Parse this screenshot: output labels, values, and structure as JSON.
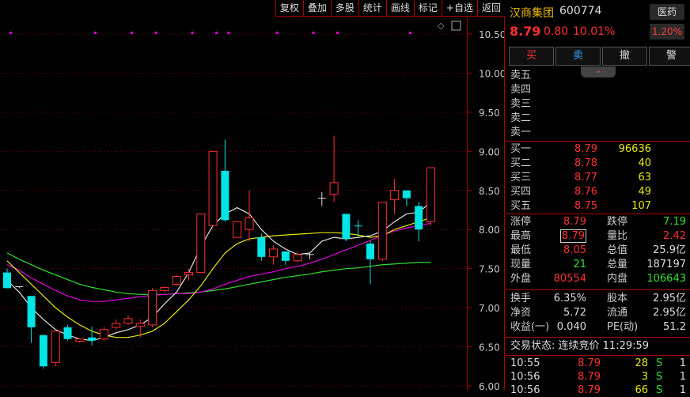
{
  "toolbar": {
    "items": [
      "复权",
      "叠加",
      "多股",
      "统计",
      "画线",
      "标记",
      "+自选",
      "返回"
    ]
  },
  "stock": {
    "name": "汉商集团",
    "code": "600774",
    "price": "8.79",
    "change": "0.80",
    "change_pct": "10.01%",
    "sector": "医药",
    "sector_pct": "1.20%"
  },
  "trade_buttons": [
    "买",
    "卖",
    "撤",
    "警"
  ],
  "order_book": {
    "asks": [
      {
        "label": "卖五",
        "price": "",
        "vol": ""
      },
      {
        "label": "卖四",
        "price": "",
        "vol": ""
      },
      {
        "label": "卖三",
        "price": "",
        "vol": ""
      },
      {
        "label": "卖二",
        "price": "",
        "vol": ""
      },
      {
        "label": "卖一",
        "price": "",
        "vol": ""
      }
    ],
    "bids": [
      {
        "label": "买一",
        "price": "8.79",
        "vol": "96636"
      },
      {
        "label": "买二",
        "price": "8.78",
        "vol": "40"
      },
      {
        "label": "买三",
        "price": "8.77",
        "vol": "63"
      },
      {
        "label": "买四",
        "price": "8.76",
        "vol": "49"
      },
      {
        "label": "买五",
        "price": "8.75",
        "vol": "107"
      }
    ]
  },
  "stats": [
    {
      "l1": "涨停",
      "v1": "8.79",
      "c1": "red",
      "l2": "跌停",
      "v2": "7.19",
      "c2": "green"
    },
    {
      "l1": "最高",
      "v1": "8.79",
      "c1": "red",
      "l2": "量比",
      "v2": "2.42",
      "c2": "red",
      "box1": true
    },
    {
      "l1": "最低",
      "v1": "8.05",
      "c1": "red",
      "l2": "总值",
      "v2": "25.9亿",
      "c2": "white"
    },
    {
      "l1": "现量",
      "v1": "21",
      "c1": "green",
      "l2": "总量",
      "v2": "187197",
      "c2": "white"
    },
    {
      "l1": "外盘",
      "v1": "80554",
      "c1": "red",
      "l2": "内盘",
      "v2": "106643",
      "c2": "green"
    }
  ],
  "stats2": [
    {
      "l1": "换手",
      "v1": "6.35%",
      "c1": "white",
      "l2": "股本",
      "v2": "2.95亿",
      "c2": "white"
    },
    {
      "l1": "净资",
      "v1": "5.72",
      "c1": "white",
      "l2": "流通",
      "v2": "2.95亿",
      "c2": "white"
    },
    {
      "l1": "收益(一)",
      "v1": "0.040",
      "c1": "white",
      "l2": "PE(动)",
      "v2": "51.2",
      "c2": "white"
    }
  ],
  "trade_status": "交易状态: 连续竞价 11:29:59",
  "ticks": [
    {
      "t": "10:55",
      "p": "8.79",
      "v": "28",
      "s": "S",
      "n": "1"
    },
    {
      "t": "10:56",
      "p": "8.79",
      "v": "3",
      "s": "S",
      "n": "1"
    },
    {
      "t": "10:56",
      "p": "8.79",
      "v": "66",
      "s": "S",
      "n": "1"
    }
  ],
  "chart_data": {
    "type": "candlestick",
    "ylim": [
      6.0,
      10.5
    ],
    "y_ticks": [
      "10.50",
      "10.00",
      "9.50",
      "9.00",
      "8.50",
      "8.00",
      "7.50",
      "7.00",
      "6.50",
      "6.00"
    ],
    "candles": [
      {
        "o": 7.45,
        "h": 7.5,
        "l": 7.25,
        "c": 7.25,
        "dir": "down"
      },
      {
        "o": 7.27,
        "h": 7.27,
        "l": 7.25,
        "c": 7.26,
        "dir": "flat"
      },
      {
        "o": 7.15,
        "h": 7.15,
        "l": 6.55,
        "c": 6.75,
        "dir": "down"
      },
      {
        "o": 6.65,
        "h": 6.65,
        "l": 6.22,
        "c": 6.25,
        "dir": "down"
      },
      {
        "o": 6.3,
        "h": 6.7,
        "l": 6.25,
        "c": 6.7,
        "dir": "up"
      },
      {
        "o": 6.75,
        "h": 6.78,
        "l": 6.58,
        "c": 6.6,
        "dir": "down"
      },
      {
        "o": 6.6,
        "h": 6.6,
        "l": 6.55,
        "c": 6.57,
        "dir": "up"
      },
      {
        "o": 6.58,
        "h": 6.76,
        "l": 6.52,
        "c": 6.62,
        "dir": "down"
      },
      {
        "o": 6.6,
        "h": 6.75,
        "l": 6.58,
        "c": 6.72,
        "dir": "up"
      },
      {
        "o": 6.75,
        "h": 6.85,
        "l": 6.72,
        "c": 6.8,
        "dir": "up"
      },
      {
        "o": 6.8,
        "h": 6.9,
        "l": 6.78,
        "c": 6.86,
        "dir": "up"
      },
      {
        "o": 6.8,
        "h": 6.85,
        "l": 6.62,
        "c": 6.76,
        "dir": "up"
      },
      {
        "o": 6.78,
        "h": 7.25,
        "l": 6.75,
        "c": 7.22,
        "dir": "up"
      },
      {
        "o": 7.22,
        "h": 7.28,
        "l": 7.2,
        "c": 7.26,
        "dir": "up"
      },
      {
        "o": 7.3,
        "h": 7.42,
        "l": 7.28,
        "c": 7.4,
        "dir": "up"
      },
      {
        "o": 7.42,
        "h": 7.5,
        "l": 7.35,
        "c": 7.45,
        "dir": "up"
      },
      {
        "o": 7.45,
        "h": 8.2,
        "l": 7.45,
        "c": 8.2,
        "dir": "up"
      },
      {
        "o": 8.05,
        "h": 9.0,
        "l": 8.05,
        "c": 9.0,
        "dir": "up"
      },
      {
        "o": 8.75,
        "h": 9.15,
        "l": 8.1,
        "c": 8.12,
        "dir": "down"
      },
      {
        "o": 7.9,
        "h": 8.1,
        "l": 7.9,
        "c": 8.1,
        "dir": "up"
      },
      {
        "o": 8.0,
        "h": 8.5,
        "l": 7.85,
        "c": 8.15,
        "dir": "up"
      },
      {
        "o": 7.9,
        "h": 7.95,
        "l": 7.6,
        "c": 7.65,
        "dir": "down"
      },
      {
        "o": 7.65,
        "h": 7.8,
        "l": 7.55,
        "c": 7.75,
        "dir": "up"
      },
      {
        "o": 7.72,
        "h": 7.72,
        "l": 7.55,
        "c": 7.6,
        "dir": "down"
      },
      {
        "o": 7.6,
        "h": 7.72,
        "l": 7.58,
        "c": 7.68,
        "dir": "up"
      },
      {
        "o": 7.68,
        "h": 7.7,
        "l": 7.62,
        "c": 7.66,
        "dir": "flat"
      },
      {
        "o": 8.4,
        "h": 8.48,
        "l": 8.3,
        "c": 8.4,
        "dir": "flat"
      },
      {
        "o": 8.45,
        "h": 9.2,
        "l": 8.35,
        "c": 8.6,
        "dir": "up"
      },
      {
        "o": 8.2,
        "h": 8.2,
        "l": 7.85,
        "c": 7.88,
        "dir": "down"
      },
      {
        "o": 8.05,
        "h": 8.12,
        "l": 7.9,
        "c": 8.05,
        "dir": "down"
      },
      {
        "o": 7.62,
        "h": 7.85,
        "l": 7.3,
        "c": 7.82,
        "dir": "down"
      },
      {
        "o": 7.62,
        "h": 8.35,
        "l": 7.6,
        "c": 8.35,
        "dir": "up"
      },
      {
        "o": 8.38,
        "h": 8.65,
        "l": 8.2,
        "c": 8.5,
        "dir": "up"
      },
      {
        "o": 8.5,
        "h": 8.5,
        "l": 8.3,
        "c": 8.4,
        "dir": "down"
      },
      {
        "o": 8.3,
        "h": 8.35,
        "l": 7.85,
        "c": 8.0,
        "dir": "down"
      },
      {
        "o": 8.1,
        "h": 8.79,
        "l": 8.05,
        "c": 8.79,
        "dir": "up"
      }
    ],
    "ma5": [
      7.35,
      7.2,
      7.0,
      6.85,
      6.72,
      6.65,
      6.6,
      6.58,
      6.62,
      6.68,
      6.72,
      6.78,
      6.88,
      7.05,
      7.2,
      7.45,
      7.78,
      8.05,
      8.2,
      8.28,
      8.2,
      8.0,
      7.85,
      7.75,
      7.68,
      7.7,
      7.85,
      7.9,
      7.88,
      7.9,
      7.92,
      7.98,
      8.1,
      8.2,
      8.22,
      8.35
    ],
    "ma10": [
      7.6,
      7.45,
      7.3,
      7.15,
      7.0,
      6.88,
      6.78,
      6.7,
      6.65,
      6.62,
      6.62,
      6.65,
      6.7,
      6.8,
      6.95,
      7.1,
      7.28,
      7.5,
      7.7,
      7.82,
      7.88,
      7.9,
      7.92,
      7.93,
      7.94,
      7.95,
      7.96,
      7.96,
      7.95,
      7.93,
      7.9,
      7.92,
      8.0,
      8.05,
      8.1,
      8.15
    ],
    "ma20": [
      7.55,
      7.48,
      7.38,
      7.3,
      7.22,
      7.15,
      7.1,
      7.08,
      7.08,
      7.1,
      7.12,
      7.14,
      7.16,
      7.17,
      7.18,
      7.18,
      7.2,
      7.24,
      7.3,
      7.35,
      7.4,
      7.43,
      7.46,
      7.5,
      7.53,
      7.57,
      7.62,
      7.68,
      7.74,
      7.8,
      7.86,
      7.93,
      7.98,
      8.02,
      8.05,
      8.08
    ],
    "ma60": [
      7.7,
      7.62,
      7.55,
      7.48,
      7.42,
      7.36,
      7.3,
      7.26,
      7.23,
      7.2,
      7.18,
      7.17,
      7.17,
      7.17,
      7.18,
      7.19,
      7.2,
      7.22,
      7.24,
      7.27,
      7.3,
      7.33,
      7.36,
      7.39,
      7.41,
      7.43,
      7.46,
      7.48,
      7.5,
      7.51,
      7.53,
      7.55,
      7.56,
      7.57,
      7.58,
      7.58
    ],
    "markers_x_index": [
      0,
      7,
      10,
      12,
      15,
      17,
      18,
      22,
      25,
      27,
      33
    ],
    "colors": {
      "up": "#ff3030",
      "down": "#00e5e5",
      "ma5": "#e0e0e0",
      "ma10": "#e8e800",
      "ma20": "#e000e0",
      "ma60": "#30e030",
      "marker": "#e000e0"
    }
  }
}
